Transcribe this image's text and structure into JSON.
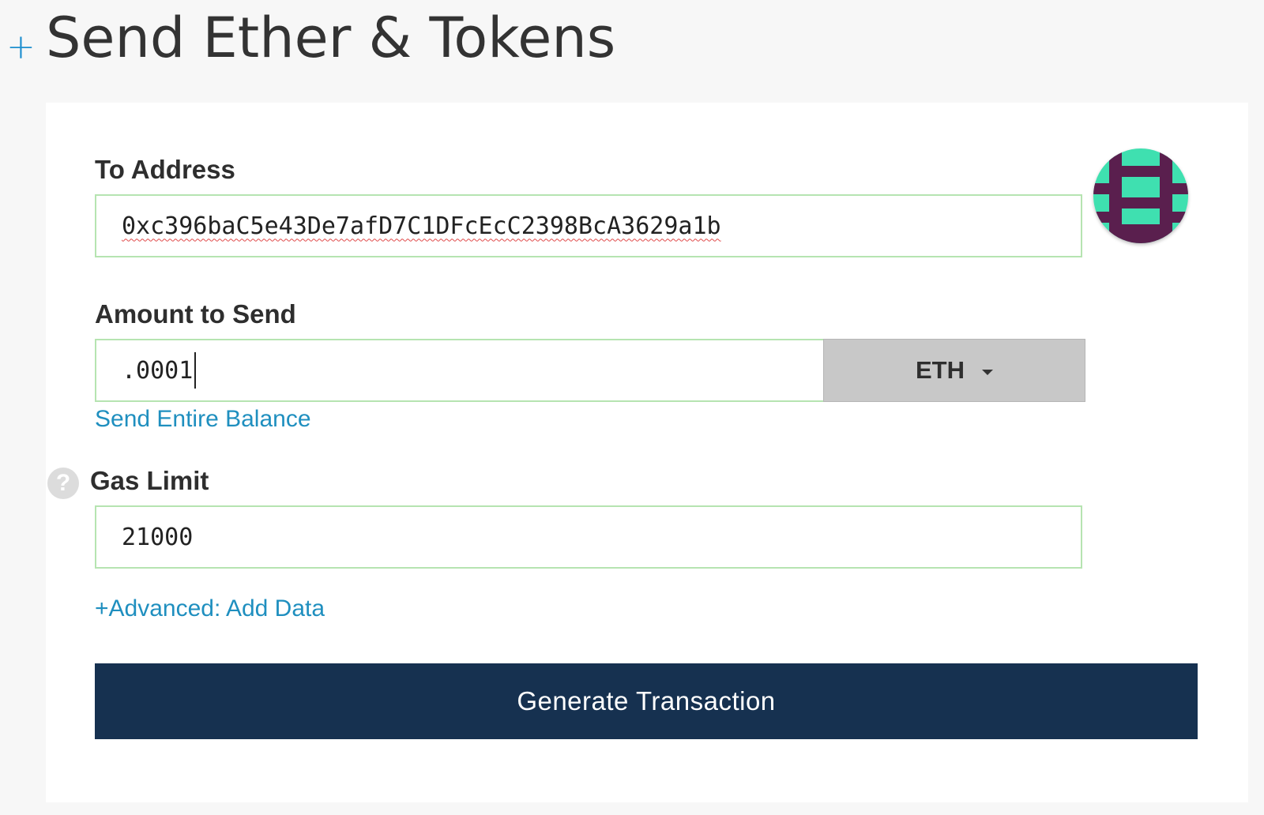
{
  "header": {
    "plus_symbol": "+",
    "title": "Send Ether & Tokens"
  },
  "form": {
    "to_address": {
      "label": "To Address",
      "value": "0xc396baC5e43De7afD7C1DFcEcC2398BcA3629a1b",
      "identicon": "address-identicon"
    },
    "amount": {
      "label": "Amount to Send",
      "value": ".0001",
      "currency": "ETH",
      "send_entire_balance": "Send Entire Balance"
    },
    "gas_limit": {
      "help_symbol": "?",
      "label": "Gas Limit",
      "value": "21000"
    },
    "advanced_link": "+Advanced: Add Data",
    "generate_button": "Generate Transaction"
  },
  "colors": {
    "accent_link": "#1f8fbf",
    "button_bg": "#163150",
    "input_border": "#b6e4b1",
    "identicon_teal": "#3fe0b0",
    "identicon_purple": "#5a1f4e"
  }
}
